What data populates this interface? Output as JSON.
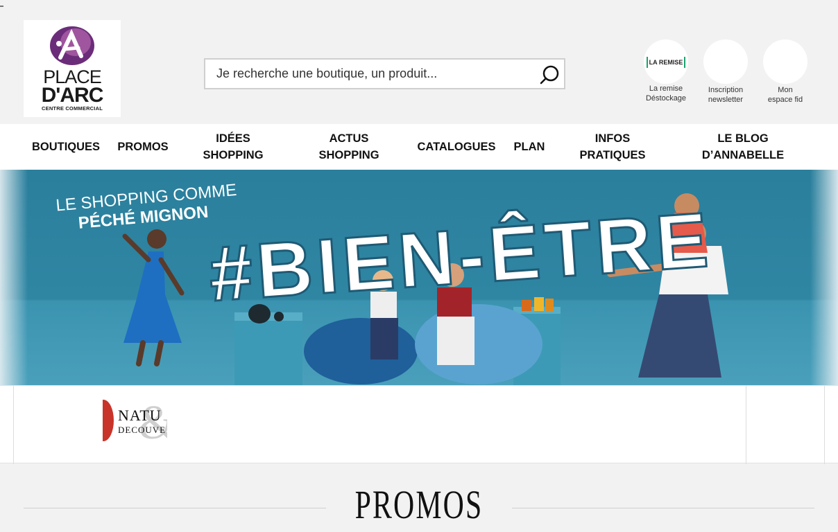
{
  "brand": {
    "logo_line1": "PLACE",
    "logo_line2": "D'ARC",
    "logo_line3": "CENTRE COMMERCIAL",
    "colors": {
      "purple": "#6b2d7a",
      "teal": "#2f86a3",
      "green": "#1aa36b"
    }
  },
  "search": {
    "placeholder": "Je recherche une boutique, un produit...",
    "icon": "search-icon"
  },
  "quick_links": [
    {
      "logo_text": "LA REMISE",
      "label_line1": "La remise",
      "label_line2": "Déstockage"
    },
    {
      "label_line1": "Inscription",
      "label_line2": "newsletter"
    },
    {
      "label_line1": "Mon",
      "label_line2": "espace fid"
    }
  ],
  "nav": {
    "items": [
      {
        "label": "BOUTIQUES"
      },
      {
        "label": "PROMOS"
      },
      {
        "label": "IDÉES SHOPPING"
      },
      {
        "label": "ACTUS SHOPPING"
      },
      {
        "label": "CATALOGUES"
      },
      {
        "label": "PLAN"
      },
      {
        "label": "INFOS PRATIQUES"
      },
      {
        "label": "LE BLOG D’ANNABELLE"
      }
    ]
  },
  "banner": {
    "tagline_line1": "LE SHOPPING COMME",
    "tagline_line2": "PÉCHÉ MIGNON",
    "headline": "#BIEN-ÊTRE"
  },
  "carousel": {
    "brand_logo_line1": "NATU",
    "brand_logo_line2": "DECOUVE",
    "brand_logo_amp": "&"
  },
  "promos": {
    "title": "PROMOS"
  }
}
